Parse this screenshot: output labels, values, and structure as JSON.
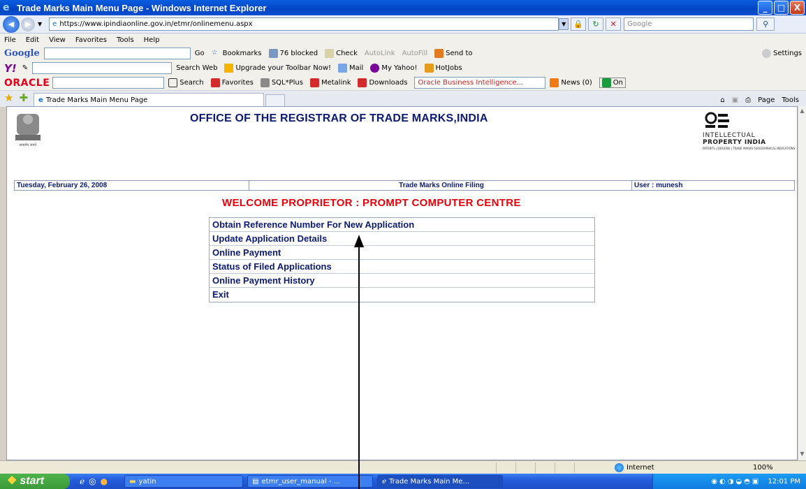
{
  "window": {
    "title": "Trade Marks Main Menu Page - Windows Internet Explorer",
    "controls": [
      "_",
      "□",
      "X"
    ]
  },
  "address": {
    "url": "https://www.ipindiaonline.gov.in/etmr/onlinemenu.aspx",
    "search_placeholder": "Google"
  },
  "menubar": [
    "File",
    "Edit",
    "View",
    "Favorites",
    "Tools",
    "Help"
  ],
  "google_toolbar": {
    "brand": "Google",
    "go": "Go",
    "bookmarks": "Bookmarks",
    "blocked": "76 blocked",
    "check": "Check",
    "autolink": "AutoLink",
    "autofill": "AutoFill",
    "sendto": "Send to",
    "settings": "Settings"
  },
  "yahoo_toolbar": {
    "brand": "Y!",
    "search_web": "Search Web",
    "upgrade": "Upgrade your Toolbar Now!",
    "mail": "Mail",
    "my_yahoo": "My Yahoo!",
    "hotjobs": "HotJobs"
  },
  "oracle_toolbar": {
    "brand": "ORACLE",
    "search": "Search",
    "favorites": "Favorites",
    "sqlplus": "SQL*Plus",
    "metalink": "Metalink",
    "downloads": "Downloads",
    "bi": "Oracle Business Intelligence...",
    "news": "News (0)",
    "on": "On"
  },
  "tab": {
    "label": "Trade Marks Main Menu Page"
  },
  "commandbar": {
    "page": "Page",
    "tools": "Tools"
  },
  "page": {
    "office_title": "OFFICE OF THE REGISTRAR OF TRADE MARKS,INDIA",
    "date": "Tuesday, February 26, 2008",
    "section": "Trade Marks Online Filing",
    "user": "User : munesh",
    "welcome": "WELCOME PROPRIETOR : PROMPT COMPUTER CENTRE",
    "emblem_caption": "सत्यमेव जयते",
    "ip_logo": {
      "line1": "INTELLECTUAL",
      "line2a": "PROPERTY ",
      "line2b": "INDIA",
      "line3": "PATENTS | DESIGNS | TRADE MARKS GEOGRAPHICAL INDICATIONS"
    },
    "menu_items": [
      "Obtain Reference Number For New Application",
      "Update Application Details",
      "Online Payment",
      "Status of Filed Applications",
      "Online Payment History",
      "Exit"
    ]
  },
  "statusbar": {
    "zone": "Internet",
    "zoom": "100%"
  },
  "taskbar": {
    "start": "start",
    "tasks": [
      "yatin",
      "etmr_user_manual - ...",
      "Trade Marks Main Me..."
    ],
    "clock": "12:01 PM"
  }
}
